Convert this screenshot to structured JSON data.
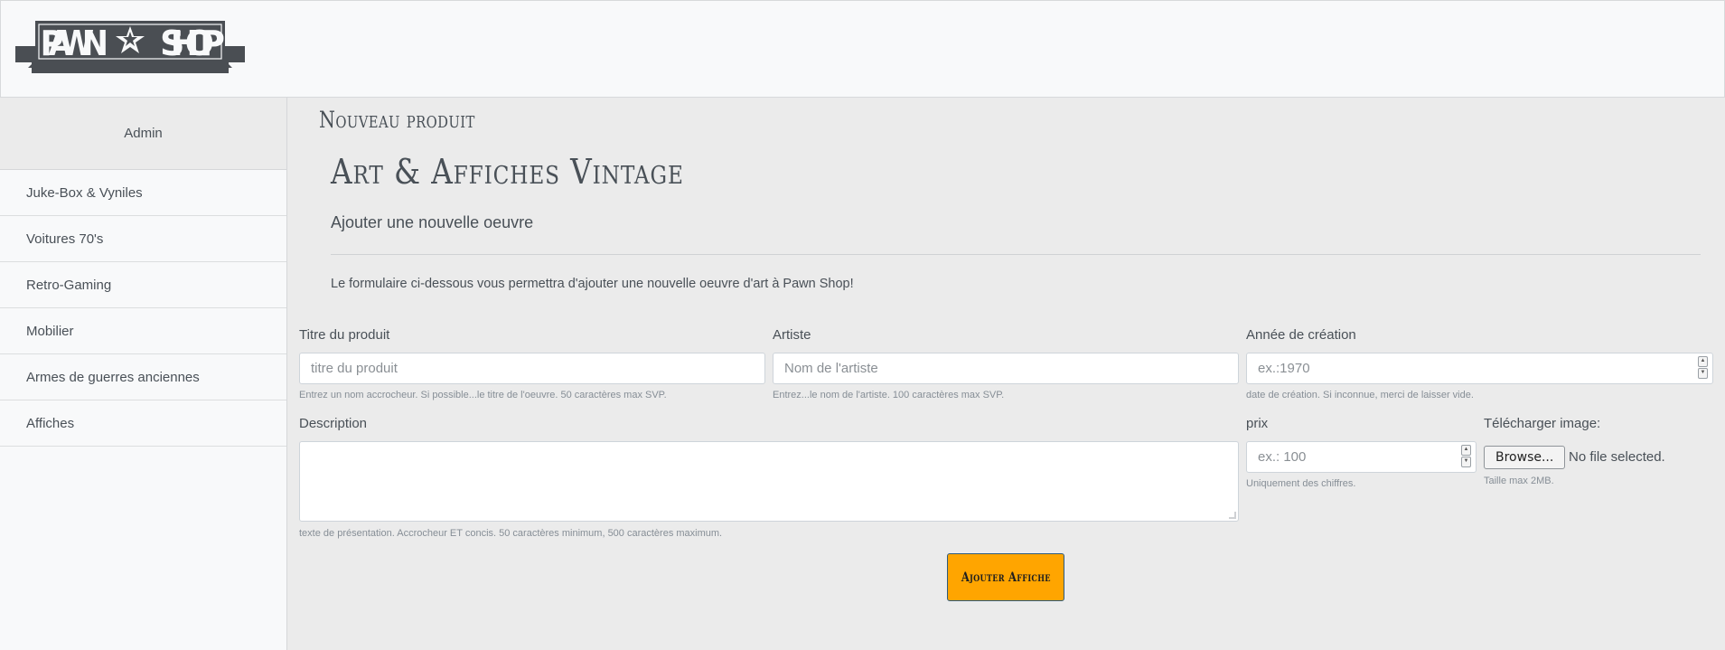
{
  "brand": {
    "logo_text_left": "PAWN",
    "logo_text_right": "SHOP"
  },
  "sidebar": {
    "admin_label": "Admin",
    "items": [
      {
        "label": "Juke-Box & Vyniles"
      },
      {
        "label": "Voitures 70's"
      },
      {
        "label": "Retro-Gaming"
      },
      {
        "label": "Mobilier"
      },
      {
        "label": "Armes de guerres anciennes"
      },
      {
        "label": "Affiches"
      }
    ]
  },
  "main": {
    "page_title": "Nouveau produit",
    "jumbotron": {
      "title": "Art & Affiches Vintage",
      "subtitle": "Ajouter une nouvelle oeuvre",
      "lead": "Le formulaire ci-dessous vous permettra d'ajouter une nouvelle oeuvre d'art à Pawn Shop!"
    }
  },
  "form": {
    "title": {
      "label": "Titre du produit",
      "placeholder": "titre du produit",
      "value": "",
      "help": "Entrez un nom accrocheur. Si possible...le titre de l'oeuvre. 50 caractères max SVP."
    },
    "artist": {
      "label": "Artiste",
      "placeholder": "Nom de l'artiste",
      "value": "",
      "help": "Entrez...le nom de l'artiste. 100 caractères max SVP."
    },
    "year": {
      "label": "Année de création",
      "placeholder": "ex.:1970",
      "value": "",
      "help": "date de création. Si inconnue, merci de laisser vide."
    },
    "description": {
      "label": "Description",
      "value": "",
      "help": "texte de présentation. Accrocheur ET concis. 50 caractères minimum, 500 caractères maximum."
    },
    "price": {
      "label": "prix",
      "placeholder": "ex.: 100",
      "value": "",
      "help": "Uniquement des chiffres."
    },
    "image": {
      "label": "Télécharger image:",
      "browse_label": "Browse...",
      "status": "No file selected.",
      "help": "Taille max 2MB."
    },
    "submit_label": "Ajouter Affiche"
  },
  "colors": {
    "accent": "#ffa500",
    "header_bg": "#f8f9fa",
    "page_bg": "#ebebeb",
    "text": "#495057"
  }
}
